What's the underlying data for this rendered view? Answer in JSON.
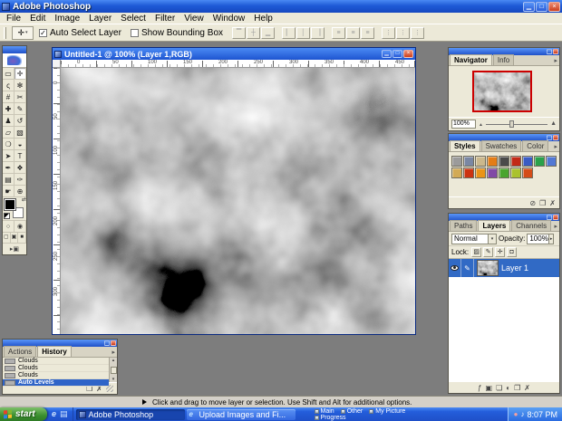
{
  "colors": {
    "titlebar_blue": "#1e55d0",
    "selection_blue": "#316ac5",
    "panel_background": "#ece9d8",
    "workspace_gray": "#7d7d7d",
    "taskbar_blue": "#245edc",
    "start_button_green": "#3a8f2e",
    "navigator_proxy_red": "#cc0000"
  },
  "window": {
    "title": "Adobe Photoshop"
  },
  "menubar": {
    "items": [
      "File",
      "Edit",
      "Image",
      "Layer",
      "Select",
      "Filter",
      "View",
      "Window",
      "Help"
    ]
  },
  "options_bar": {
    "active_tool": "move-tool-icon",
    "checkboxes": [
      {
        "label": "Auto Select Layer",
        "checked": true
      },
      {
        "label": "Show Bounding Box",
        "checked": false
      }
    ],
    "align_groups": [
      [
        "align-top-icon",
        "align-vcenter-icon",
        "align-bottom-icon"
      ],
      [
        "align-left-icon",
        "align-hcenter-icon",
        "align-right-icon"
      ],
      [
        "distribute-top-icon",
        "distribute-vcenter-icon",
        "distribute-bottom-icon"
      ],
      [
        "distribute-left-icon",
        "distribute-hcenter-icon",
        "distribute-right-icon"
      ]
    ]
  },
  "toolbox": {
    "tools": [
      {
        "name": "rectangular-marquee-tool",
        "glyph": "▭"
      },
      {
        "name": "move-tool",
        "glyph": "✛",
        "active": true
      },
      {
        "name": "lasso-tool",
        "glyph": "ς"
      },
      {
        "name": "magic-wand-tool",
        "glyph": "✻"
      },
      {
        "name": "crop-tool",
        "glyph": "#"
      },
      {
        "name": "slice-tool",
        "glyph": "✂"
      },
      {
        "name": "healing-brush-tool",
        "glyph": "✚"
      },
      {
        "name": "brush-tool",
        "glyph": "✎"
      },
      {
        "name": "clone-stamp-tool",
        "glyph": "♟"
      },
      {
        "name": "history-brush-tool",
        "glyph": "↺"
      },
      {
        "name": "eraser-tool",
        "glyph": "▱"
      },
      {
        "name": "gradient-tool",
        "glyph": "▧"
      },
      {
        "name": "blur-tool",
        "glyph": "❍"
      },
      {
        "name": "dodge-tool",
        "glyph": "◒"
      },
      {
        "name": "path-selection-tool",
        "glyph": "➤"
      },
      {
        "name": "type-tool",
        "glyph": "T"
      },
      {
        "name": "pen-tool",
        "glyph": "✒"
      },
      {
        "name": "custom-shape-tool",
        "glyph": "❖"
      },
      {
        "name": "notes-tool",
        "glyph": "▤"
      },
      {
        "name": "eyedropper-tool",
        "glyph": "✑"
      },
      {
        "name": "hand-tool",
        "glyph": "☛"
      },
      {
        "name": "zoom-tool",
        "glyph": "⊕"
      }
    ],
    "foreground_color": "#000000",
    "background_color": "#ffffff"
  },
  "document": {
    "title": "Untitled-1 @ 100% (Layer 1,RGB)",
    "ruler_top": [
      "0",
      "50",
      "100",
      "150",
      "200",
      "250",
      "300",
      "350",
      "400",
      "450"
    ],
    "ruler_left": [
      "0",
      "50",
      "100",
      "150",
      "200",
      "250",
      "300"
    ]
  },
  "navigator": {
    "tabs": [
      {
        "label": "Navigator",
        "active": true
      },
      {
        "label": "Info",
        "active": false
      }
    ],
    "zoom": "100%"
  },
  "styles_panel": {
    "tabs": [
      {
        "label": "Styles",
        "active": true
      },
      {
        "label": "Swatches",
        "active": false
      },
      {
        "label": "Color",
        "active": false
      }
    ],
    "swatches": [
      "#9b9b9b",
      "#7a87a3",
      "#cbb88c",
      "#e47d17",
      "#4a4a4a",
      "#c22a17",
      "#3a5cc4",
      "#2aa14b",
      "#5278d4",
      "#d2aa55",
      "#cc3311",
      "#ea9418",
      "#8149a6",
      "#4aa52e",
      "#aac22e",
      "#d44c17"
    ],
    "bottom_icons": [
      "clear-style-icon",
      "new-style-icon",
      "delete-style-icon"
    ]
  },
  "layers_panel": {
    "tabs": [
      {
        "label": "Paths",
        "active": false
      },
      {
        "label": "Layers",
        "active": true
      },
      {
        "label": "Channels",
        "active": false
      }
    ],
    "blend_mode": "Normal",
    "opacity_label": "Opacity:",
    "opacity_value": "100%",
    "lock_label": "Lock:",
    "lock_icons": [
      "lock-transparency-icon",
      "lock-image-icon",
      "lock-position-icon",
      "lock-all-icon"
    ],
    "layers": [
      {
        "name": "Layer 1",
        "visible": true,
        "selected": true
      }
    ],
    "bottom_icons": [
      "layer-style-icon",
      "layer-mask-icon",
      "layer-set-icon",
      "adjustment-layer-icon",
      "new-layer-icon",
      "delete-layer-icon"
    ]
  },
  "history_panel": {
    "tabs": [
      {
        "label": "Actions",
        "active": false
      },
      {
        "label": "History",
        "active": true
      }
    ],
    "items": [
      {
        "label": "Clouds",
        "selected": false
      },
      {
        "label": "Clouds",
        "selected": false
      },
      {
        "label": "Clouds",
        "selected": false
      },
      {
        "label": "Auto Levels",
        "selected": true
      }
    ],
    "bottom_icons": [
      "new-snapshot-icon",
      "delete-state-icon"
    ]
  },
  "status_bar": {
    "hint": "Click and drag to move layer or selection. Use Shift and Alt for additional options."
  },
  "taskbar": {
    "start_label": "start",
    "quick_launch": [
      "internet-explorer-icon",
      "show-desktop-icon"
    ],
    "tasks": [
      {
        "label": "Adobe Photoshop",
        "icon": "photoshop-icon",
        "active": true
      },
      {
        "label": "Upload Images and Fi...",
        "icon": "internet-explorer-icon",
        "active": false
      }
    ],
    "desktop_toolbar_items": [
      "Main",
      "Other",
      "My Picture",
      "Progress"
    ],
    "tray_icons": [
      "tray-shield-icon",
      "volume-icon"
    ],
    "clock": "8:07 PM"
  }
}
